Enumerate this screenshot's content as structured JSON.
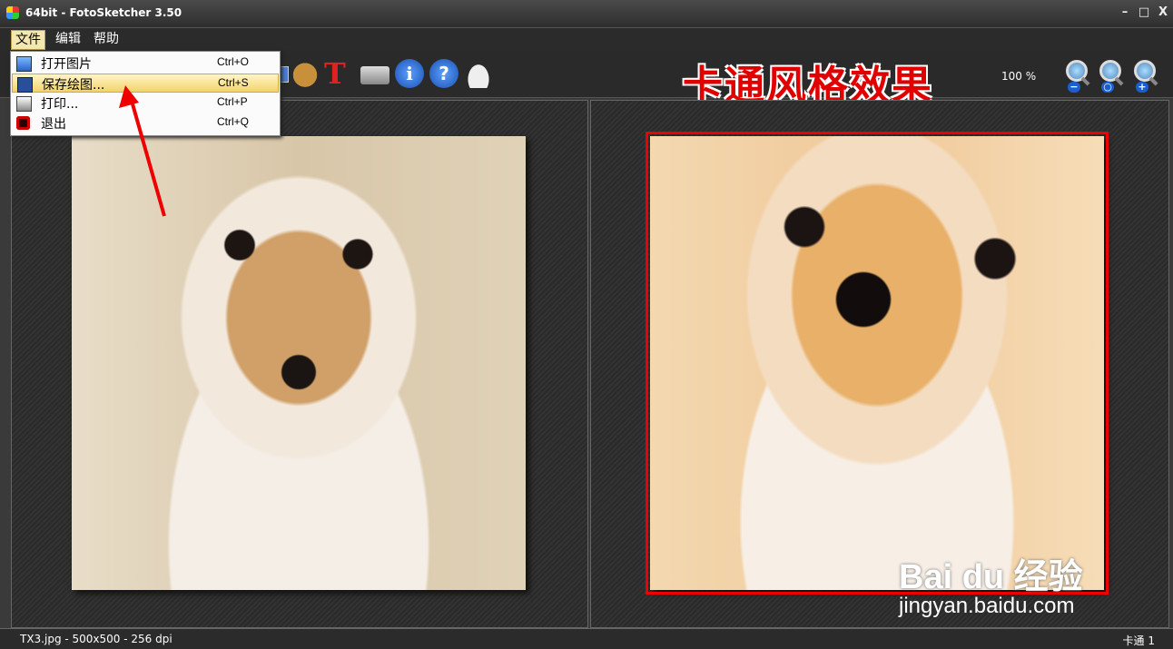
{
  "window": {
    "title": "64bit - FotoSketcher 3.50",
    "min": "–",
    "max": "□",
    "close": "X"
  },
  "menu": {
    "file": "文件",
    "edit": "编辑",
    "help": "帮助"
  },
  "file_menu": [
    {
      "label": "打开图片",
      "shortcut": "Ctrl+O",
      "icon": "open-image-icon"
    },
    {
      "label": "保存绘图...",
      "shortcut": "Ctrl+S",
      "icon": "save-icon",
      "highlighted": true
    },
    {
      "label": "打印...",
      "shortcut": "Ctrl+P",
      "icon": "print-icon"
    },
    {
      "label": "退出",
      "shortcut": "Ctrl+Q",
      "icon": "exit-icon"
    }
  ],
  "toolbar": {
    "text_tool": "T",
    "info_tool": "i",
    "help_tool": "?",
    "zoom": "100 %"
  },
  "caption": "卡通风格效果",
  "status": {
    "file_info": "TX3.jpg - 500x500 - 256 dpi",
    "style": "卡通 1"
  },
  "watermark": {
    "logo": "Bai du 经验",
    "url": "jingyan.baidu.com"
  },
  "colors": {
    "caption": "#e00000",
    "highlight": "#f3d46a",
    "frame": "#e00000"
  }
}
